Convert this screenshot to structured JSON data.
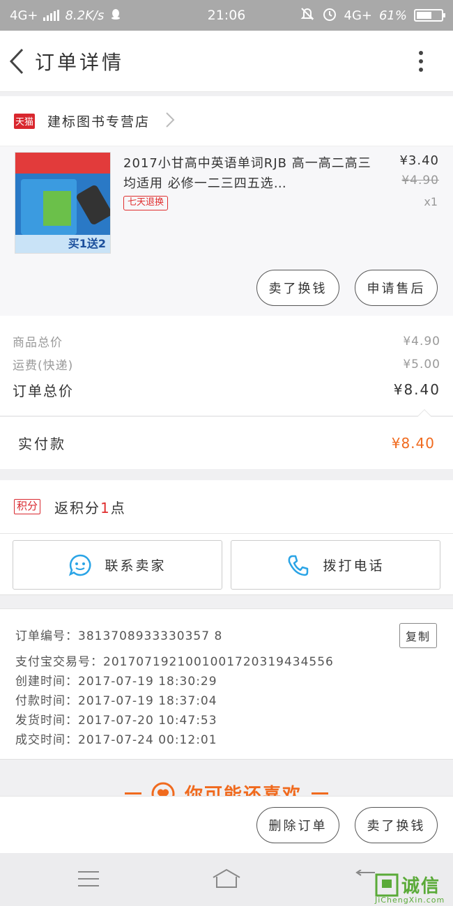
{
  "status_bar": {
    "network": "4G+",
    "speed": "8.2K/s",
    "time": "21:06",
    "network_right": "4G+",
    "battery": "61%",
    "battery_level": 0.61
  },
  "nav": {
    "title": "订单详情"
  },
  "shop": {
    "badge": "天猫",
    "name": "建标图书专营店"
  },
  "product": {
    "title": "2017小甘高中英语单词RJB 高一高二高三均适用 必修一二三四五选…",
    "tag": "七天退换",
    "price": "¥3.40",
    "original_price": "¥4.90",
    "quantity": "x1",
    "image_promo": "买1送2",
    "buttons": [
      "卖了换钱",
      "申请售后"
    ]
  },
  "summary": {
    "goods_label": "商品总价",
    "goods_value": "¥4.90",
    "shipping_label": "运费(快递)",
    "shipping_value": "¥5.00",
    "total_label": "订单总价",
    "total_value": "¥8.40",
    "paid_label": "实付款",
    "paid_value": "¥8.40"
  },
  "points": {
    "badge": "积分",
    "text_before": "返积分",
    "count": "1",
    "text_after": "点"
  },
  "contact": {
    "seller_label": "联系卖家",
    "phone_label": "拨打电话"
  },
  "order_info": {
    "order_no": "订单编号：3813708933330357 8",
    "alipay_no": "支付宝交易号：2017071921001001720319434556",
    "created": "创建时间：2017-07-19 18:30:29",
    "paid": "付款时间：2017-07-19 18:37:04",
    "shipped": "发货时间：2017-07-20 10:47:53",
    "completed": "成交时间：2017-07-24 00:12:01",
    "copy_label": "复制"
  },
  "recommend": {
    "title": "你可能还喜欢"
  },
  "bottom_actions": {
    "delete_label": "删除订单",
    "sell_label": "卖了换钱"
  },
  "watermark": {
    "text": "诚信",
    "site": "JiChengXin.com"
  },
  "colors": {
    "accent_orange": "#f06a1e",
    "tmall_red": "#d9272e",
    "icon_blue": "#2aa4e6"
  }
}
